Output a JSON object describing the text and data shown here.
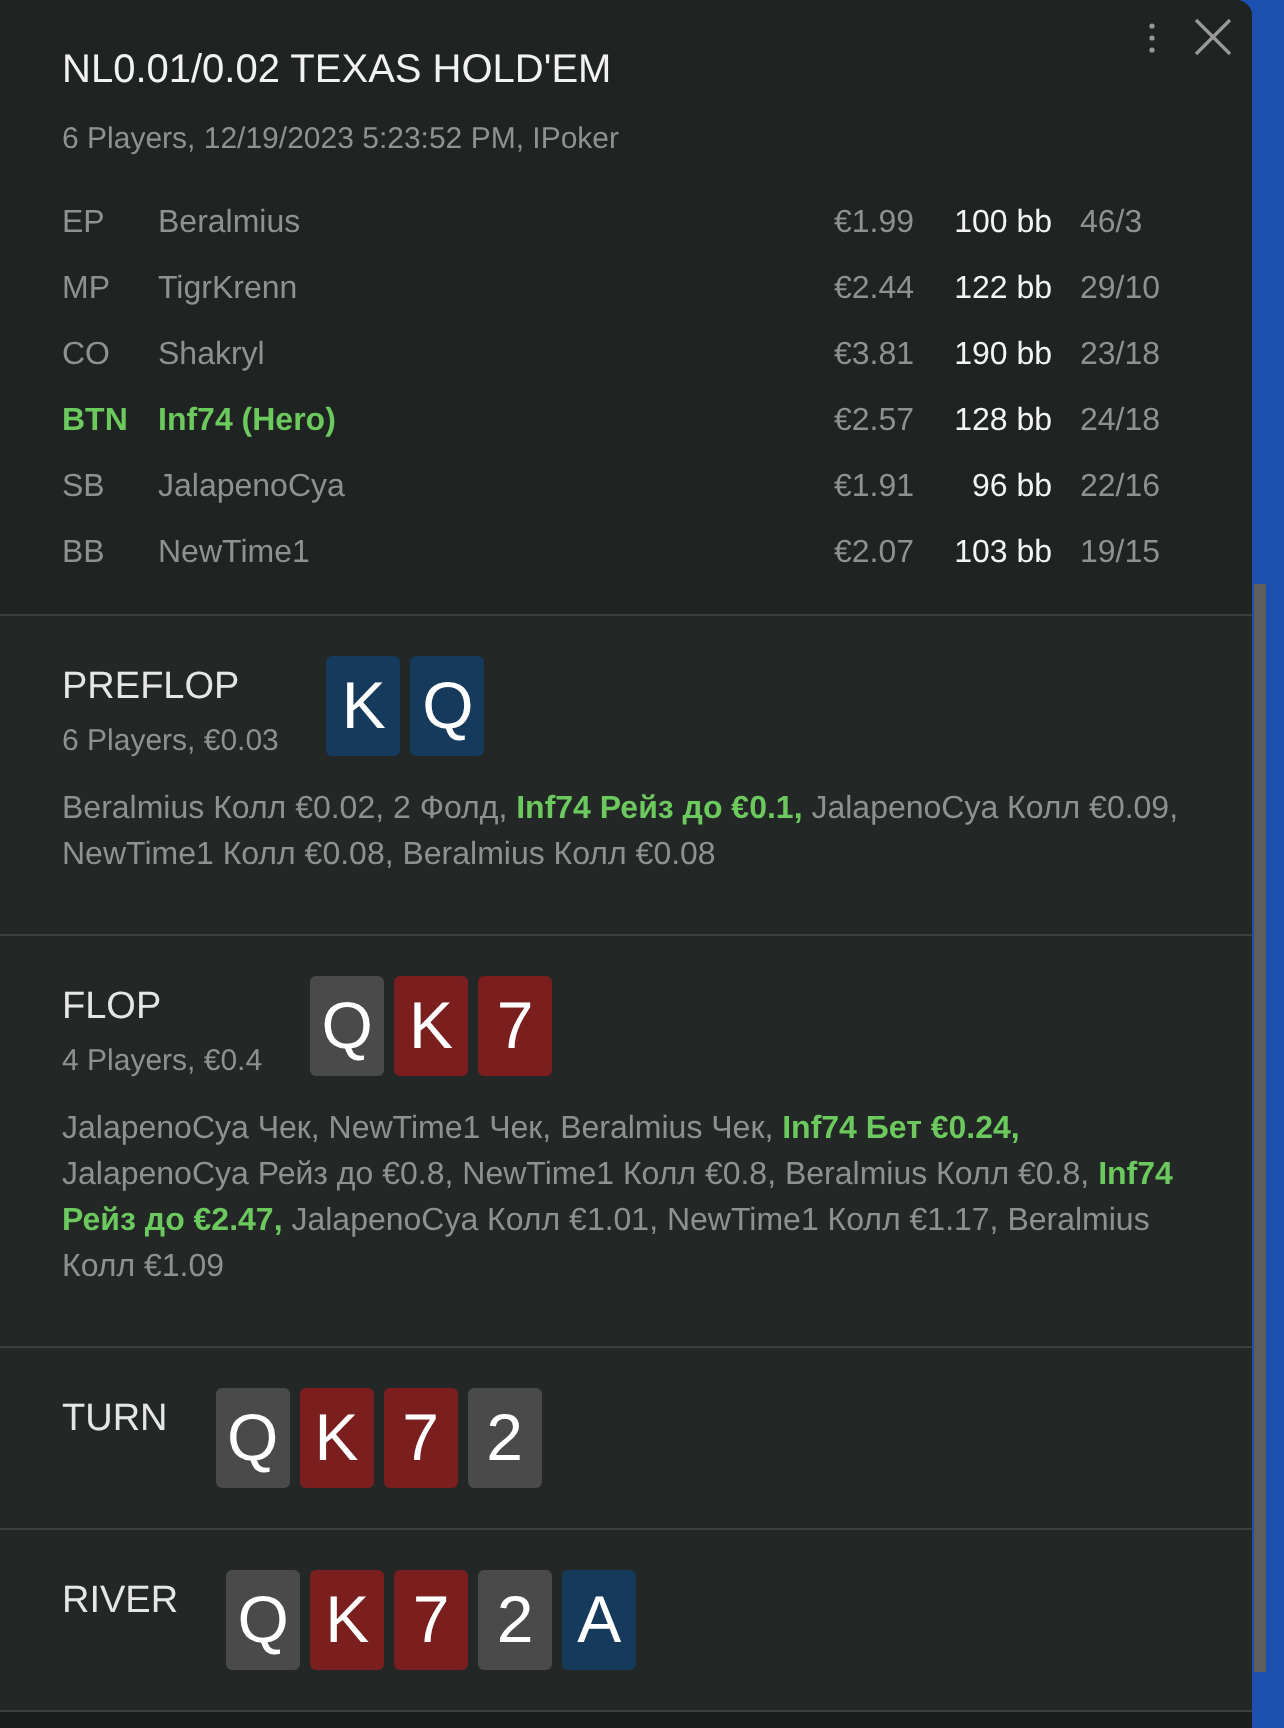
{
  "header": {
    "title": "NL0.01/0.02 TEXAS HOLD'EM",
    "subtitle": "6 Players, 12/19/2023 5:23:52 PM, IPoker"
  },
  "players": [
    {
      "position": "EP",
      "name": "Beralmius",
      "stack": "€1.99",
      "stack_bb": "100 bb",
      "stats": "46/3",
      "hero": false
    },
    {
      "position": "MP",
      "name": "TigrKrenn",
      "stack": "€2.44",
      "stack_bb": "122 bb",
      "stats": "29/10",
      "hero": false
    },
    {
      "position": "CO",
      "name": "Shakryl",
      "stack": "€3.81",
      "stack_bb": "190 bb",
      "stats": "23/18",
      "hero": false
    },
    {
      "position": "BTN",
      "name": "Inf74 (Hero)",
      "stack": "€2.57",
      "stack_bb": "128 bb",
      "stats": "24/18",
      "hero": true
    },
    {
      "position": "SB",
      "name": "JalapenoCya",
      "stack": "€1.91",
      "stack_bb": "96 bb",
      "stats": "22/16",
      "hero": false
    },
    {
      "position": "BB",
      "name": "NewTime1",
      "stack": "€2.07",
      "stack_bb": "103 bb",
      "stats": "19/15",
      "hero": false
    }
  ],
  "streets": [
    {
      "name": "PREFLOP",
      "summary": "6 Players, €0.03",
      "cards": [
        {
          "rank": "K",
          "color": "#163a5c"
        },
        {
          "rank": "Q",
          "color": "#163a5c"
        }
      ],
      "actions": "Beralmius Колл €0.02, 2 Фолд, **Inf74 Рейз до €0.1,** JalapenoCya Колл €0.09, NewTime1 Колл €0.08, Beralmius Колл €0.08"
    },
    {
      "name": "FLOP",
      "summary": "4 Players, €0.4",
      "cards": [
        {
          "rank": "Q",
          "color": "#4a4a4a"
        },
        {
          "rank": "K",
          "color": "#7a1e1e"
        },
        {
          "rank": "7",
          "color": "#7a1e1e"
        }
      ],
      "actions": "JalapenoCya Чек, NewTime1 Чек, Beralmius Чек, **Inf74 Бет €0.24,** JalapenoCya Рейз до €0.8, NewTime1 Колл €0.8, Beralmius Колл €0.8, **Inf74 Рейз до €2.47,** JalapenoCya Колл €1.01, NewTime1 Колл €1.17, Beralmius Колл €1.09"
    },
    {
      "name": "TURN",
      "cards": [
        {
          "rank": "Q",
          "color": "#4a4a4a"
        },
        {
          "rank": "K",
          "color": "#7a1e1e"
        },
        {
          "rank": "7",
          "color": "#7a1e1e"
        },
        {
          "rank": "2",
          "color": "#4a4a4a"
        }
      ]
    },
    {
      "name": "RIVER",
      "cards": [
        {
          "rank": "Q",
          "color": "#4a4a4a"
        },
        {
          "rank": "K",
          "color": "#7a1e1e"
        },
        {
          "rank": "7",
          "color": "#7a1e1e"
        },
        {
          "rank": "2",
          "color": "#4a4a4a"
        },
        {
          "rank": "A",
          "color": "#163a5c"
        }
      ]
    }
  ]
}
